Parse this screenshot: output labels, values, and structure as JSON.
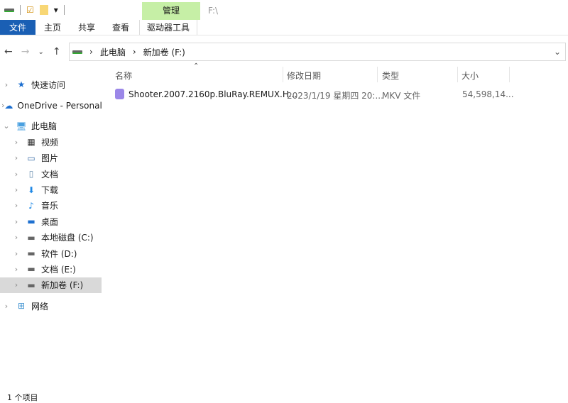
{
  "quick_access_toolbar": {
    "dropdown": "▾"
  },
  "ribbon": {
    "context_tab": "管理",
    "title": "F:\\",
    "tabs": [
      "文件",
      "主页",
      "共享",
      "查看"
    ],
    "context_label": "驱动器工具"
  },
  "address": {
    "crumbs": [
      "此电脑",
      "新加卷 (F:)"
    ]
  },
  "tree": [
    {
      "label": "快速访问",
      "icon": "star-icon",
      "level": 0
    },
    {
      "label": "OneDrive - Personal",
      "icon": "cloud-icon",
      "level": 0
    },
    {
      "label": "此电脑",
      "icon": "computer-icon",
      "level": 0
    },
    {
      "label": "视频",
      "icon": "video-icon",
      "level": 1
    },
    {
      "label": "图片",
      "icon": "picture-icon",
      "level": 1
    },
    {
      "label": "文档",
      "icon": "document-icon",
      "level": 1
    },
    {
      "label": "下载",
      "icon": "download-icon",
      "level": 1
    },
    {
      "label": "音乐",
      "icon": "music-icon",
      "level": 1
    },
    {
      "label": "桌面",
      "icon": "desktop-icon",
      "level": 1
    },
    {
      "label": "本地磁盘 (C:)",
      "icon": "drive-icon",
      "level": 1
    },
    {
      "label": "软件 (D:)",
      "icon": "drive-icon",
      "level": 1
    },
    {
      "label": "文档 (E:)",
      "icon": "drive-icon",
      "level": 1
    },
    {
      "label": "新加卷 (F:)",
      "icon": "drive-icon",
      "level": 1
    },
    {
      "label": "网络",
      "icon": "network-icon",
      "level": 0
    }
  ],
  "columns": [
    "名称",
    "修改日期",
    "类型",
    "大小"
  ],
  "files": [
    {
      "name": "Shooter.2007.2160p.BluRay.REMUX.H...",
      "date": "2023/1/19 星期四 20:...",
      "type": "MKV 文件",
      "size": "54,598,14..."
    }
  ],
  "status": "1 个项目",
  "colors": {
    "file_tab": "#1a5fb4",
    "context_tab": "#c6efa6",
    "selected": "#d9d9d9"
  }
}
